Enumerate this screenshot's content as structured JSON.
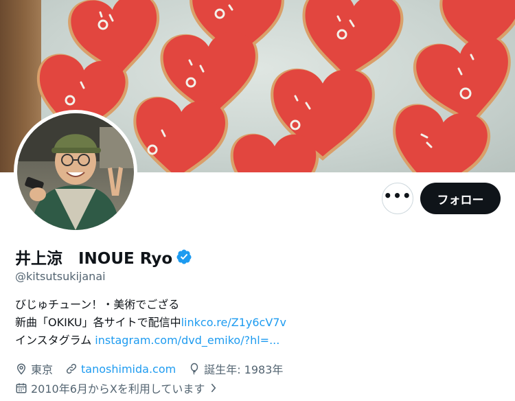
{
  "profile": {
    "display_name": "井上涼　INOUE Ryo",
    "handle": "@kitsutsukijanai",
    "verified": true
  },
  "actions": {
    "more_label": "•••",
    "follow_label": "フォロー"
  },
  "bio": {
    "line1": "びじゅチューン！・美術でござる",
    "line2_text": "新曲「OKIKU」各サイトで配信中",
    "line2_link": "linkco.re/Z1y6cV7v",
    "line3_text": "インスタグラム ",
    "line3_link": "instagram.com/dvd_emiko/?hl=..."
  },
  "meta": {
    "location": "東京",
    "website": "tanoshimida.com",
    "birth": "誕生年: 1983年",
    "joined": "2010年6月からXを利用しています"
  },
  "colors": {
    "accent": "#1d9bf0",
    "text": "#0f1419",
    "muted": "#536471",
    "cookie": "#e2463f"
  }
}
